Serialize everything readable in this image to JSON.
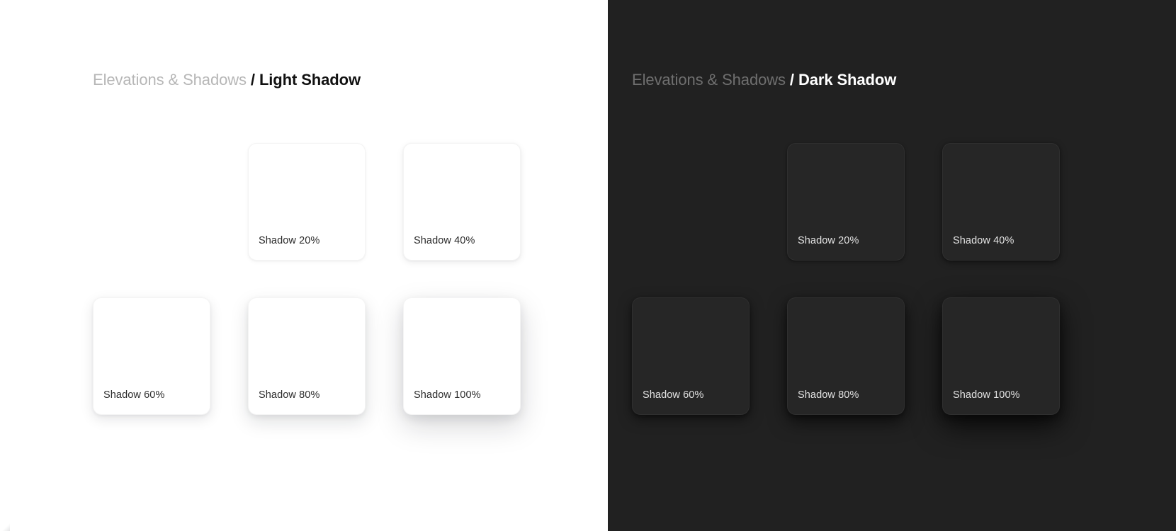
{
  "panels": [
    {
      "theme": "light",
      "background": "#ffffff",
      "card_background": "#ffffff",
      "label_color": "#2b2b2b",
      "breadcrumb": {
        "root": "Elevations & Shadows",
        "separator": "/",
        "leaf": "Light Shadow",
        "root_color": "#b6b6b6",
        "leaf_color": "#111111"
      },
      "cards": [
        {
          "visible": false,
          "label": "",
          "level": 0
        },
        {
          "visible": true,
          "label": "Shadow 20%",
          "level": 20
        },
        {
          "visible": true,
          "label": "Shadow 40%",
          "level": 40
        },
        {
          "visible": true,
          "label": "Shadow 60%",
          "level": 60
        },
        {
          "visible": true,
          "label": "Shadow 80%",
          "level": 80
        },
        {
          "visible": true,
          "label": "Shadow 100%",
          "level": 100
        }
      ]
    },
    {
      "theme": "dark",
      "background": "#212121",
      "card_background": "#262626",
      "label_color": "#e3e3e3",
      "breadcrumb": {
        "root": "Elevations & Shadows",
        "separator": "/",
        "leaf": "Dark Shadow",
        "root_color": "#6f6f6f",
        "leaf_color": "#ffffff"
      },
      "cards": [
        {
          "visible": false,
          "label": "",
          "level": 0
        },
        {
          "visible": true,
          "label": "Shadow 20%",
          "level": 20
        },
        {
          "visible": true,
          "label": "Shadow 40%",
          "level": 40
        },
        {
          "visible": true,
          "label": "Shadow 60%",
          "level": 60
        },
        {
          "visible": true,
          "label": "Shadow 80%",
          "level": 80
        },
        {
          "visible": true,
          "label": "Shadow 100%",
          "level": 100
        }
      ]
    }
  ]
}
